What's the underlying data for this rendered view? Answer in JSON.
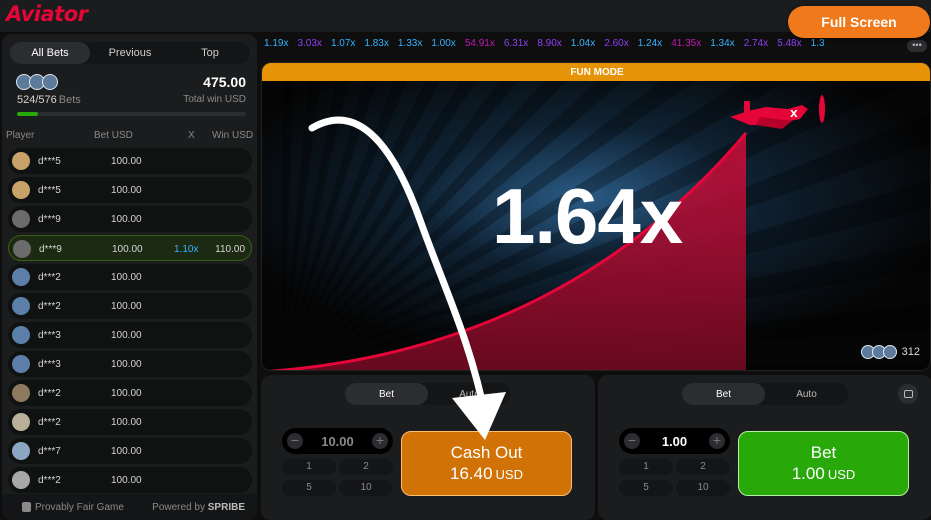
{
  "header": {
    "logo": "Aviator",
    "fullscreen_label": "Full Screen"
  },
  "left_panel": {
    "tabs": [
      {
        "label": "All Bets",
        "active": true
      },
      {
        "label": "Previous",
        "active": false
      },
      {
        "label": "Top",
        "active": false
      }
    ],
    "bets_count": "524/576",
    "bets_label": "Bets",
    "total_win": "475.00",
    "total_win_label": "Total win USD",
    "progress_fraction": 0.09,
    "columns": {
      "player": "Player",
      "bet": "Bet USD",
      "mult": "X",
      "win": "Win USD"
    },
    "rows": [
      {
        "player": "d***5",
        "bet": "100.00",
        "mult": "",
        "win": "",
        "avatar_color": "#c9a26a"
      },
      {
        "player": "d***5",
        "bet": "100.00",
        "mult": "",
        "win": "",
        "avatar_color": "#c9a26a"
      },
      {
        "player": "d***9",
        "bet": "100.00",
        "mult": "",
        "win": "",
        "avatar_color": "#6b6b6b"
      },
      {
        "player": "d***9",
        "bet": "100.00",
        "mult": "1.10x",
        "win": "110.00",
        "avatar_color": "#6b6b6b",
        "won": true
      },
      {
        "player": "d***2",
        "bet": "100.00",
        "mult": "",
        "win": "",
        "avatar_color": "#5b7fa8"
      },
      {
        "player": "d***2",
        "bet": "100.00",
        "mult": "",
        "win": "",
        "avatar_color": "#5b7fa8"
      },
      {
        "player": "d***3",
        "bet": "100.00",
        "mult": "",
        "win": "",
        "avatar_color": "#5b7fa8"
      },
      {
        "player": "d***3",
        "bet": "100.00",
        "mult": "",
        "win": "",
        "avatar_color": "#5b7fa8"
      },
      {
        "player": "d***2",
        "bet": "100.00",
        "mult": "",
        "win": "",
        "avatar_color": "#8d7a5e"
      },
      {
        "player": "d***2",
        "bet": "100.00",
        "mult": "",
        "win": "",
        "avatar_color": "#b9b09a"
      },
      {
        "player": "d***7",
        "bet": "100.00",
        "mult": "",
        "win": "",
        "avatar_color": "#8aa6c2"
      },
      {
        "player": "d***2",
        "bet": "100.00",
        "mult": "",
        "win": "",
        "avatar_color": "#a8a8a8"
      }
    ],
    "footer": {
      "provably_fair": "Provably Fair Game",
      "powered_by": "Powered by",
      "powered_brand": "SPRIBE"
    }
  },
  "history": [
    {
      "value": "1.19x",
      "color": "#34b4ff"
    },
    {
      "value": "3.03x",
      "color": "#913ef8"
    },
    {
      "value": "1.07x",
      "color": "#34b4ff"
    },
    {
      "value": "1.83x",
      "color": "#34b4ff"
    },
    {
      "value": "1.33x",
      "color": "#34b4ff"
    },
    {
      "value": "1.00x",
      "color": "#34b4ff"
    },
    {
      "value": "54.91x",
      "color": "#c017b4"
    },
    {
      "value": "6.31x",
      "color": "#913ef8"
    },
    {
      "value": "8.90x",
      "color": "#913ef8"
    },
    {
      "value": "1.04x",
      "color": "#34b4ff"
    },
    {
      "value": "2.60x",
      "color": "#913ef8"
    },
    {
      "value": "1.24x",
      "color": "#34b4ff"
    },
    {
      "value": "41.35x",
      "color": "#c017b4"
    },
    {
      "value": "1.34x",
      "color": "#34b4ff"
    },
    {
      "value": "2.74x",
      "color": "#913ef8"
    },
    {
      "value": "5.48x",
      "color": "#913ef8"
    },
    {
      "value": "1.3",
      "color": "#34b4ff"
    }
  ],
  "game": {
    "mode_banner": "FUN MODE",
    "multiplier": "1.64x",
    "online_count": "312"
  },
  "panel_a": {
    "tabs": [
      {
        "label": "Bet",
        "active": true
      },
      {
        "label": "Auto",
        "active": false
      }
    ],
    "amount": "10.00",
    "quick": [
      "1",
      "2",
      "5",
      "10"
    ],
    "button_title": "Cash Out",
    "button_amount": "16.40",
    "button_currency": "USD"
  },
  "panel_b": {
    "tabs": [
      {
        "label": "Bet",
        "active": true
      },
      {
        "label": "Auto",
        "active": false
      }
    ],
    "amount": "1.00",
    "quick": [
      "1",
      "2",
      "5",
      "10"
    ],
    "button_title": "Bet",
    "button_amount": "1.00",
    "button_currency": "USD"
  },
  "colors": {
    "brand_red": "#e50539",
    "accent_orange": "#f0791c",
    "cashout_orange": "#d07206",
    "bet_green": "#28a909",
    "history_blue": "#34b4ff",
    "history_purple": "#913ef8",
    "history_magenta": "#c017b4"
  }
}
